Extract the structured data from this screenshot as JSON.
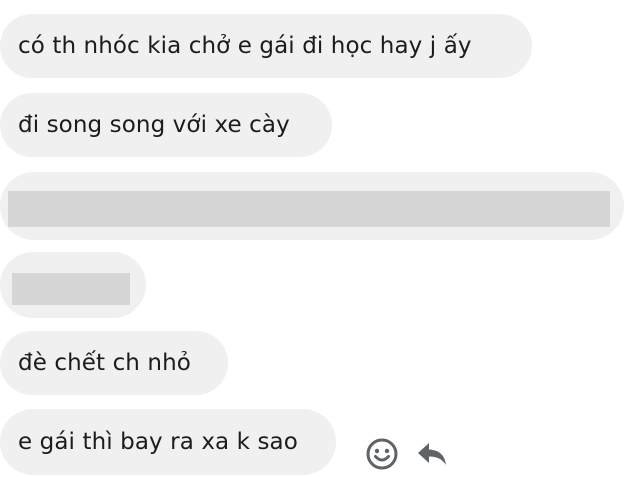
{
  "messages": [
    {
      "text": "có th nhóc kia chở e gái đi học hay j ấy",
      "redacted": false
    },
    {
      "text": "đi song song với xe cày",
      "redacted": false
    },
    {
      "text": "",
      "redacted": true
    },
    {
      "text": "",
      "redacted": true
    },
    {
      "text": "đè chết ch nhỏ",
      "redacted": false
    },
    {
      "text": "e gái thì bay ra xa k sao",
      "redacted": false
    }
  ],
  "actions": {
    "react_icon": "smiley-face-icon",
    "reply_icon": "reply-arrow-icon"
  },
  "colors": {
    "bubble": "#f0f0f0",
    "redaction": "#d6d6d6",
    "text": "#1c1c1c",
    "icon": "#5f6368"
  }
}
